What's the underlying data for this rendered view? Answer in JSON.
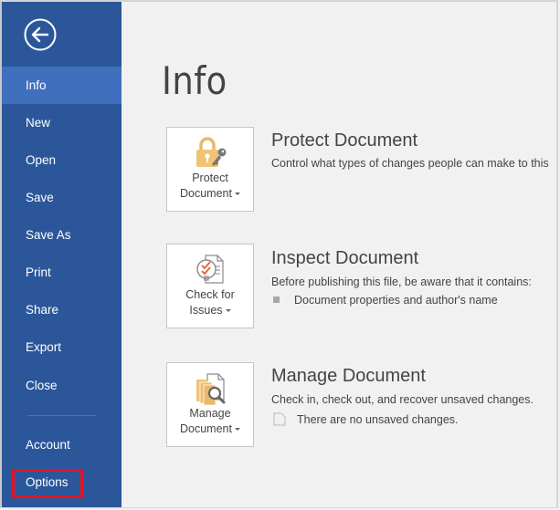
{
  "sidebar": {
    "back_icon": "arrow-left-circle-icon",
    "items": [
      {
        "label": "Info",
        "active": true
      },
      {
        "label": "New"
      },
      {
        "label": "Open"
      },
      {
        "label": "Save"
      },
      {
        "label": "Save As"
      },
      {
        "label": "Print"
      },
      {
        "label": "Share"
      },
      {
        "label": "Export"
      },
      {
        "label": "Close"
      }
    ],
    "bottom_items": [
      {
        "label": "Account"
      },
      {
        "label": "Options",
        "highlighted": true
      }
    ],
    "colors": {
      "background": "#2b579a",
      "active": "#3f6fbd",
      "highlight_border": "#e81123"
    }
  },
  "main": {
    "title": "Info",
    "sections": [
      {
        "tile_icon": "lock-key-icon",
        "tile_line1": "Protect",
        "tile_line2": "Document",
        "title": "Protect Document",
        "description": "Control what types of changes people can make to this"
      },
      {
        "tile_icon": "inspect-checklist-icon",
        "tile_line1": "Check for",
        "tile_line2": "Issues",
        "title": "Inspect Document",
        "description": "Before publishing this file, be aware that it contains:",
        "bullets": [
          "Document properties and author's name"
        ]
      },
      {
        "tile_icon": "manage-documents-search-icon",
        "tile_line1": "Manage",
        "tile_line2": "Document",
        "title": "Manage Document",
        "description": "Check in, check out, and recover unsaved changes.",
        "status": "There are no unsaved changes."
      }
    ]
  }
}
